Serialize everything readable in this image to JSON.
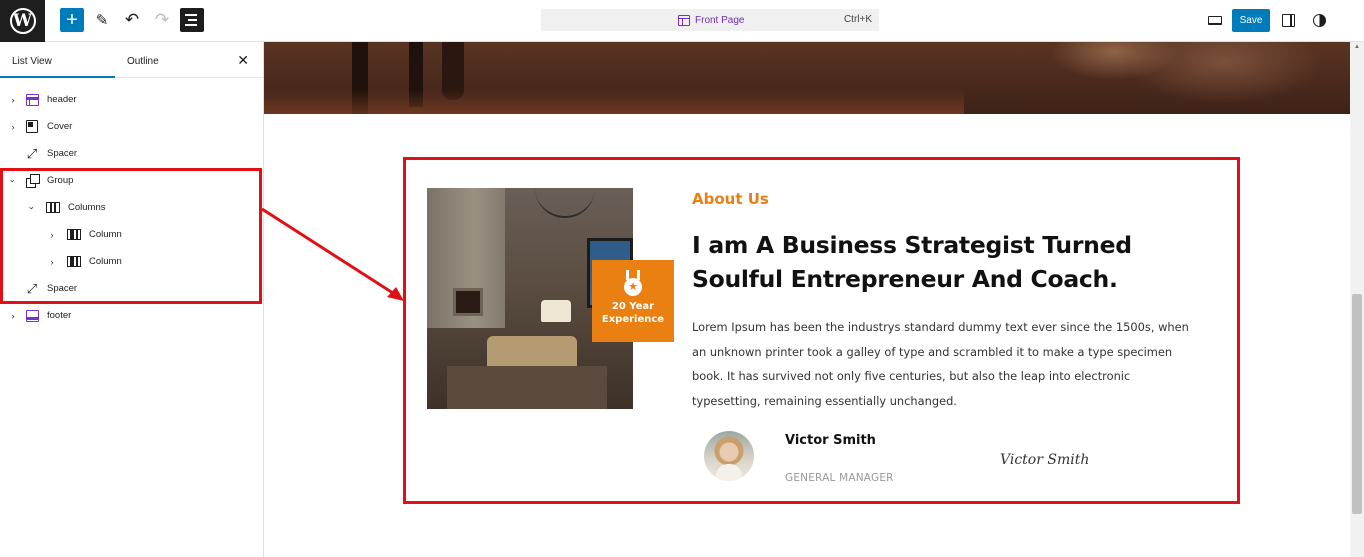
{
  "toolbar": {
    "logo": "W",
    "add_icon": "+",
    "tools_icon": "✎",
    "undo_icon": "↶",
    "redo_icon": "↷",
    "document_title": "Front Page",
    "shortcut": "Ctrl+K",
    "save_label": "Save"
  },
  "sidebar": {
    "tabs": [
      "List View",
      "Outline"
    ],
    "close_icon": "✕",
    "items": [
      {
        "label": "header",
        "icon": "template-part-icon",
        "expanded": false
      },
      {
        "label": "Cover",
        "icon": "cover-icon",
        "expanded": false
      },
      {
        "label": "Spacer",
        "icon": "resize-icon"
      },
      {
        "label": "Group",
        "icon": "group-icon",
        "expanded": true
      },
      {
        "label": "Columns",
        "icon": "columns-icon",
        "expanded": true
      },
      {
        "label": "Column",
        "icon": "column-icon",
        "expanded": false
      },
      {
        "label": "Column",
        "icon": "column-icon",
        "expanded": false
      },
      {
        "label": "Spacer",
        "icon": "resize-icon"
      },
      {
        "label": "footer",
        "icon": "template-part-icon",
        "expanded": false
      }
    ]
  },
  "content": {
    "badge_line1": "20 Year",
    "badge_line2": "Experience",
    "about_label": "About Us",
    "heading": "I am A Business Strategist Turned Soulful Entrepreneur And Coach.",
    "body": "Lorem Ipsum has been the industrys standard dummy text ever since the 1500s, when an unknown printer took a galley of type and scrambled it to make a type specimen book. It has survived not only five centuries, but also the leap into electronic typesetting, remaining essentially unchanged.",
    "person_name": "Victor Smith",
    "person_role": "GENERAL MANAGER",
    "signature": "Victor Smith"
  },
  "colors": {
    "accent": "#ea7f12",
    "highlight": "#e10f16",
    "primary_button": "#007cba",
    "template_part": "#7a2fd0"
  }
}
